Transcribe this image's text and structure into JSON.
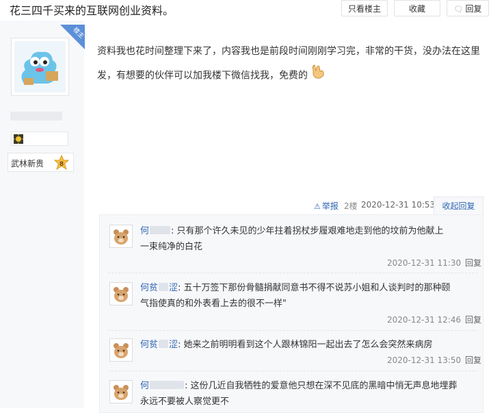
{
  "thread": {
    "title": "花三四千买来的互联网创业资料。",
    "buttons": {
      "only_op": "只看楼主",
      "favorite": "收藏",
      "reply": "回复"
    },
    "reply_icon": "chat-bubble-icon"
  },
  "author": {
    "badge": "楼主",
    "rank_name": "武林新贵",
    "rank_level": "8",
    "avatar_icon": "blue-creature-avatar-icon",
    "level_icon": "sun-level-icon"
  },
  "post": {
    "line1": "资料我也花时间整理下来了，内容我也是前段时间刚刚学习完，非常的干货，没办法在这里",
    "line2": "发，有想要的伙伴可以加我楼下微信找我，免费的",
    "emoji_icon": "rock-hand-emoji-icon",
    "report": "举报",
    "floor": "2楼",
    "date": "2020-12-31 10:53",
    "collapse_reply": "收起回复"
  },
  "comments": [
    {
      "name_a": "何",
      "name_b": "",
      "text_l1": ": 只有那个许久未见的少年拄着拐杖步履艰难地走到他的坟前为他献上",
      "text_l2": "一束纯净的白花",
      "date": "2020-12-31 11:30",
      "reply": "回复"
    },
    {
      "name_a": "何贫",
      "name_b": "涩",
      "text_l1": ": 五十万签下那份骨髓捐献同意书不得不说苏小姐和人谈判时的那种颐",
      "text_l2": "气指使真的和外表看上去的很不一样\"",
      "date": "2020-12-31 12:46",
      "reply": "回复"
    },
    {
      "name_a": "何贫",
      "name_b": "涩",
      "text_l1": ": 她来之前明明看到这个人跟林锦阳一起出去了怎么会突然来病房",
      "text_l2": "",
      "date": "2020-12-31 13:50",
      "reply": "回复"
    },
    {
      "name_a": "何",
      "name_b": "",
      "text_l1": ": 这份几近自我牺牲的爱意他只想在深不见底的黑暗中悄无声息地埋葬",
      "text_l2": "永远不要被人察觉更不",
      "date": "",
      "reply": ""
    }
  ],
  "comment_avatar_icon": "bear-avatar-icon",
  "colors": {
    "link": "#2d64b3",
    "panel": "#f7f8fa",
    "badge": "#5b8fd8"
  }
}
